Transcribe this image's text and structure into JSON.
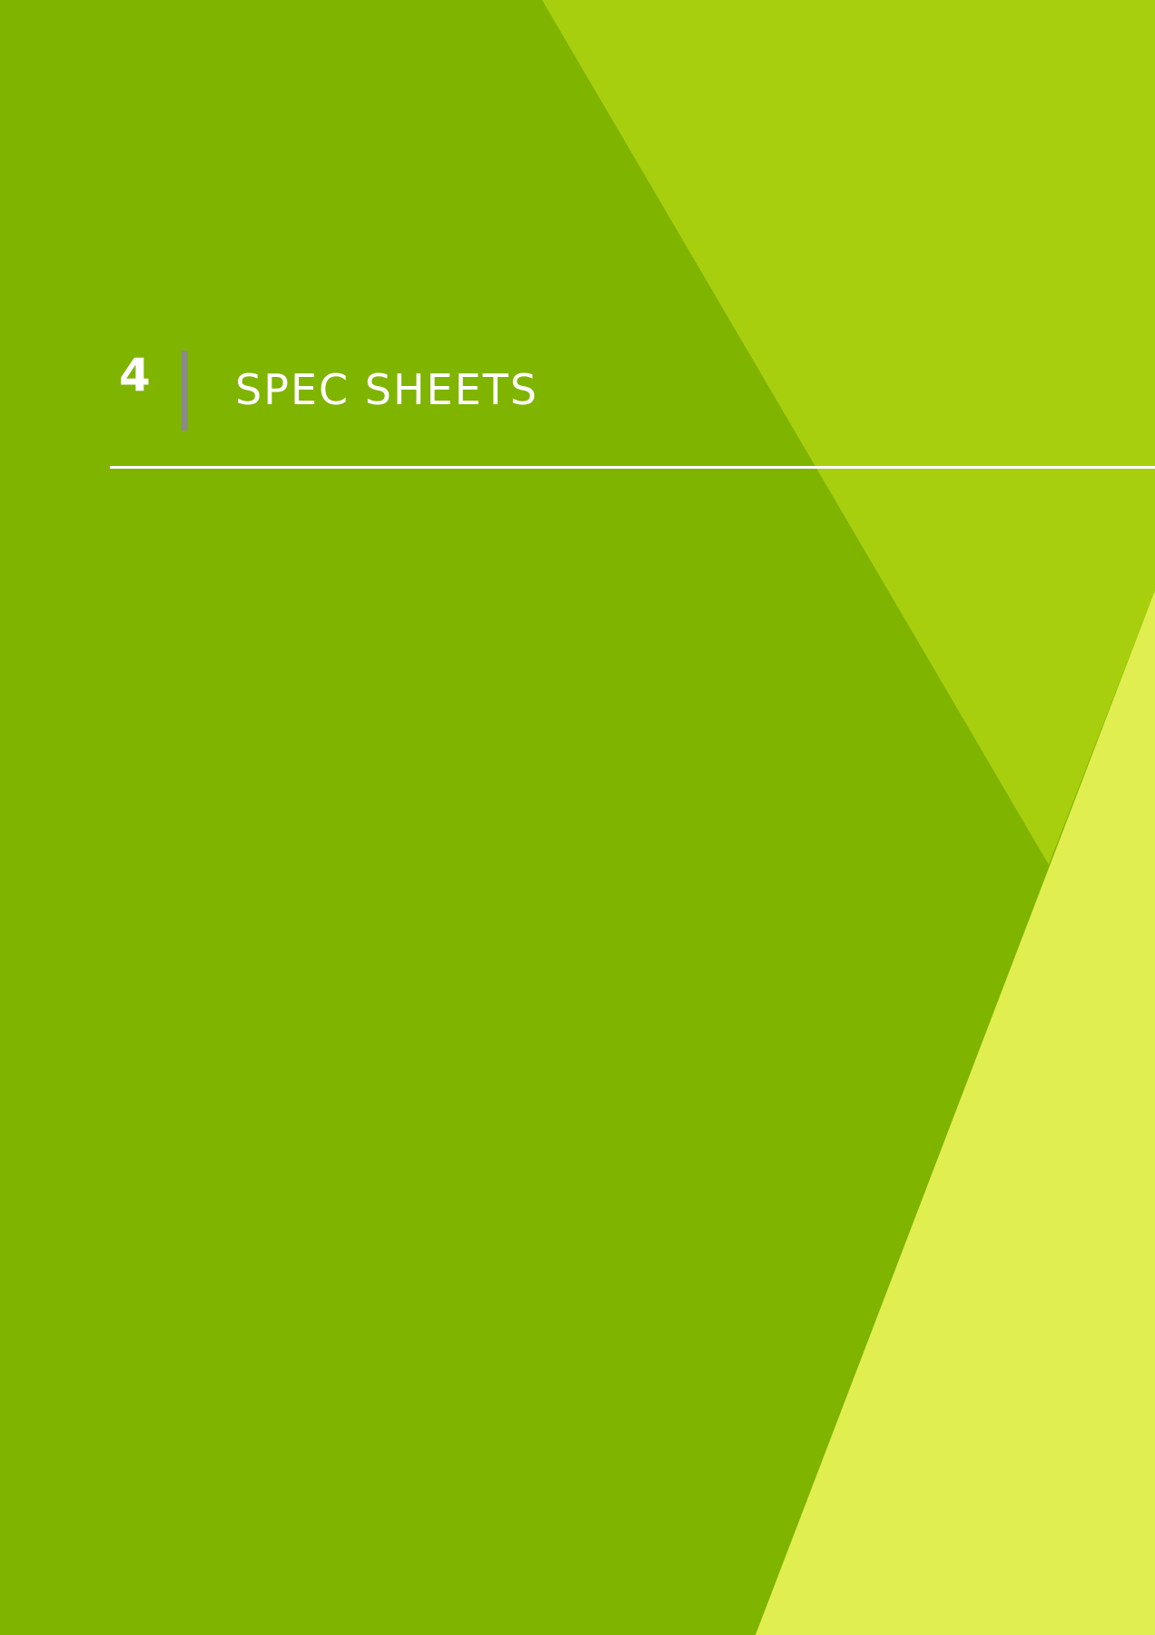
{
  "colors": {
    "background": "#7fb400",
    "upper_right_panel": "#a8cf0d",
    "lower_right_panel": "#e1ee50",
    "divider_bar": "#8a8a8a",
    "text": "#ffffff"
  },
  "chapter": {
    "number": "4",
    "title": "SPEC SHEETS"
  }
}
